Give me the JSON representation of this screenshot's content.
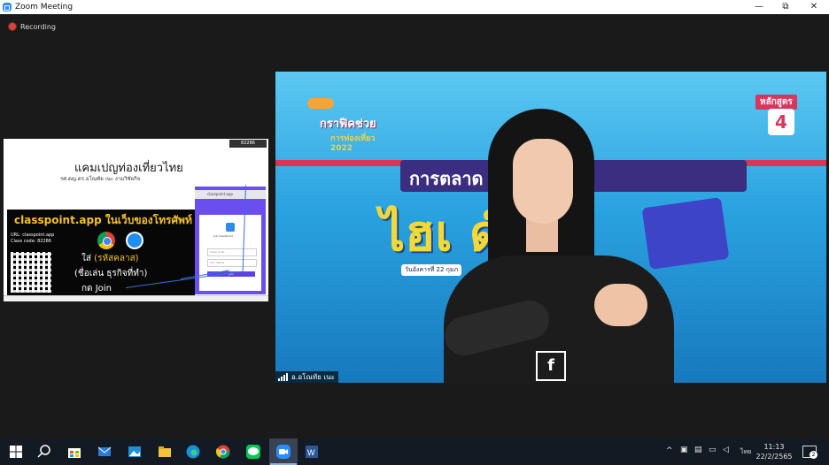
{
  "window": {
    "title": "Zoom Meeting",
    "minimize": "—",
    "restore": "⧉",
    "close": "✕"
  },
  "recording": {
    "label": "Recording"
  },
  "shared_screen": {
    "heading": "แคมเปญท่องเที่ยวไทย",
    "author": "รศ.ดญ.ดร.อโณทัย เนะ งามวิชัยกิจ",
    "badge": "82286",
    "banner": "classpoint.app ในเว็บของโทรศัพท์",
    "url_line": "URL: classpoint.app",
    "code_line": "Class code: 82286",
    "line1_prefix": "ใส่ ",
    "line1_highlight": "(รหัสคลาส)",
    "line2": "(ชื่อเล่น ธุรกิจที่ทำ)",
    "line3": "กด Join",
    "browser_url": "classpoint.app",
    "app_name": "Join ClassPoint",
    "field1": "Class Code",
    "field2": "Your Name",
    "button": "Join"
  },
  "video": {
    "participant_name": "อ.อโณทัย เนะ",
    "logo_line1": "กราฟิคช่วย",
    "logo_line2": "การท่องเที่ยว 2022",
    "banner_text": "การตลาด                  เที่ยวไทย",
    "big_text": "ไฮเ   ด์",
    "date_text": "วันอังคารที่ 22 กุมภ",
    "course_label": "หลักสูตร",
    "course_number": "4",
    "shirt_icon": "f"
  },
  "taskbar": {
    "lang": "ไทย",
    "time": "11:13",
    "date": "22/2/2565",
    "notification_count": "2"
  },
  "icons": {
    "windows": "windows-icon",
    "search": "search-icon",
    "store": "store-icon",
    "mail": "mail-icon",
    "photos": "photos-icon",
    "explorer": "file-explorer-icon",
    "edge": "edge-icon",
    "chrome": "chrome-icon",
    "line": "line-icon",
    "zoom": "zoom-icon",
    "word": "word-icon"
  }
}
